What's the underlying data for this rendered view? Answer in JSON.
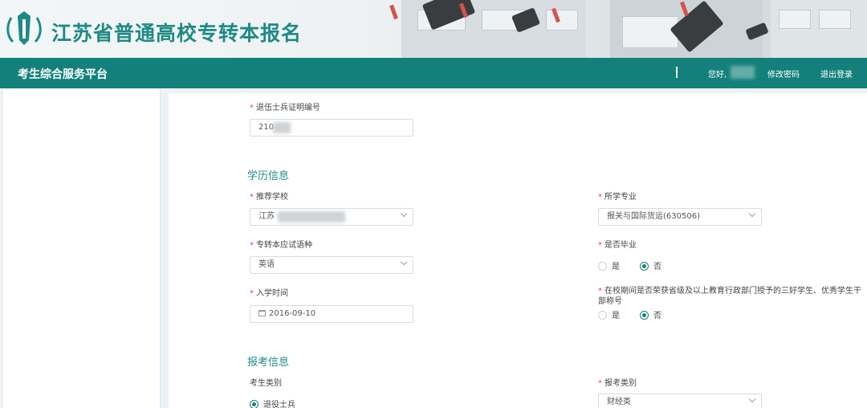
{
  "header": {
    "site_title": "江苏省普通高校专转本报名",
    "platform_title": "考生综合服务平台",
    "separator": "|",
    "greeting": "您好,",
    "change_password": "修改密码",
    "logout": "退出登录"
  },
  "form": {
    "veteran_id": {
      "label": "退伍士兵证明编号",
      "value": "210"
    },
    "education_section": "学历信息",
    "recommend_school": {
      "label": "推荐学校",
      "value": "江苏"
    },
    "major": {
      "label": "所学专业",
      "value": "报关与国际货运(630506)"
    },
    "exam_language": {
      "label": "专转本应试语种",
      "value": "英语"
    },
    "graduated": {
      "label": "是否毕业",
      "options": [
        "是",
        "否"
      ],
      "selected": "否"
    },
    "enroll_date": {
      "label": "入学时间",
      "value": "2016-09-10"
    },
    "honors": {
      "label": "在校期间是否荣获省级及以上教育行政部门授予的三好学生、优秀学生干部称号",
      "options": [
        "是",
        "否"
      ],
      "selected": "否"
    },
    "registration_section": "报考信息",
    "candidate_type": {
      "label": "考生类别",
      "option": "退役士兵"
    },
    "apply_category": {
      "label": "报考类别",
      "value": "财经类"
    }
  },
  "required_mark": "*"
}
